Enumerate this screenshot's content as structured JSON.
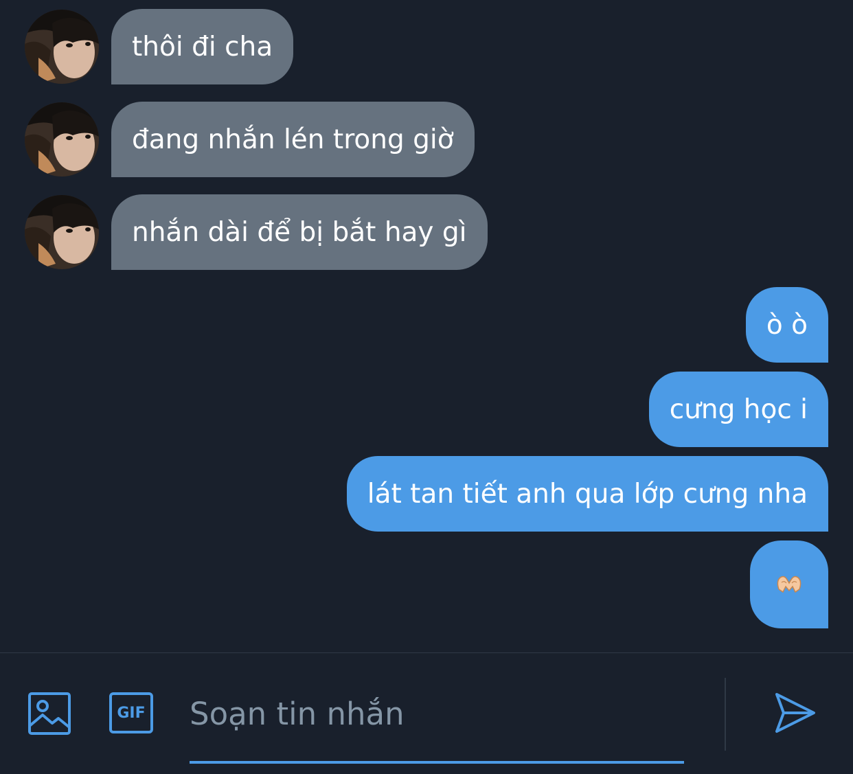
{
  "conversation": {
    "messages": [
      {
        "from": "other",
        "text": "thôi đi cha"
      },
      {
        "from": "other",
        "text": "đang nhắn lén trong giờ"
      },
      {
        "from": "other",
        "text": "nhắn dài để bị bắt hay gì"
      },
      {
        "from": "me",
        "text": "ò ò"
      },
      {
        "from": "me",
        "text": "cưng học i"
      },
      {
        "from": "me",
        "text": "lát tan tiết anh qua lớp cưng nha"
      },
      {
        "from": "me",
        "emoji": "heart-hands-emoji"
      }
    ]
  },
  "composer": {
    "placeholder": "Soạn tin nhắn",
    "gif_label": "GIF",
    "icons": [
      "image-icon",
      "gif-icon",
      "send-icon"
    ]
  },
  "theme": {
    "background": "#19202c",
    "incoming_bubble": "#66727f",
    "outgoing_bubble": "#4c9be6",
    "accent": "#4c9be6"
  }
}
